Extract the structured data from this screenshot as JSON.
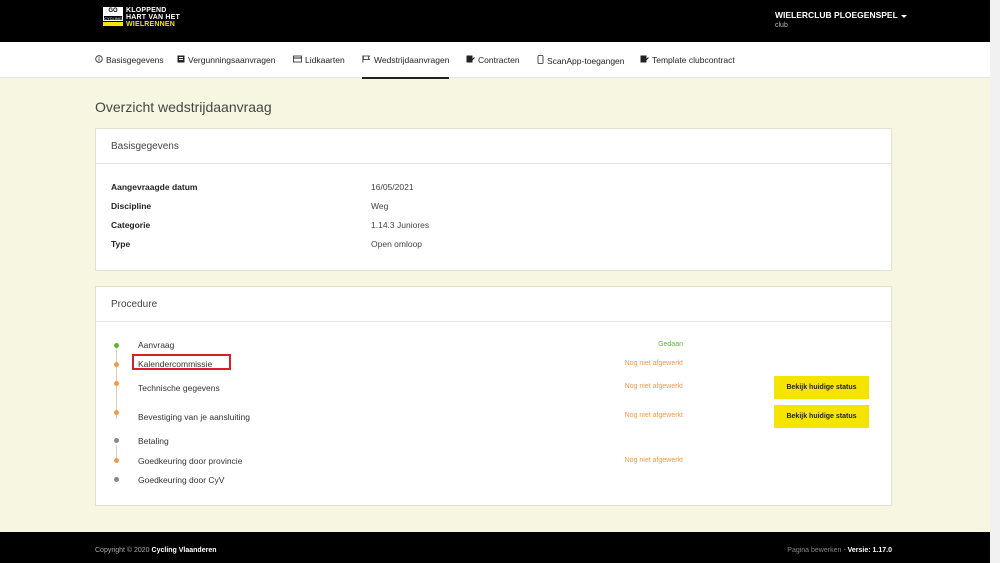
{
  "header": {
    "logo": {
      "badge_top": "GO",
      "badge_mid": "CYCLING",
      "line1": "KLOPPEND",
      "line2": "HART VAN HET",
      "line3": "WIELRENNEN"
    },
    "club_name": "WIELERCLUB PLOEGENSPEL",
    "club_role": "club"
  },
  "nav": {
    "items": [
      {
        "label": "Basisgegevens",
        "icon": "info-circle-icon"
      },
      {
        "label": "Vergunningsaanvragen",
        "icon": "id-card-icon"
      },
      {
        "label": "Lidkaarten",
        "icon": "card-icon"
      },
      {
        "label": "Wedstrijdaanvragen",
        "icon": "flag-icon",
        "active": true
      },
      {
        "label": "Contracten",
        "icon": "pen-doc-icon"
      },
      {
        "label": "ScanApp-toegangen",
        "icon": "mobile-icon"
      },
      {
        "label": "Template clubcontract",
        "icon": "pen-doc-icon"
      }
    ]
  },
  "page_title": "Overzicht wedstrijdaanvraag",
  "basis": {
    "title": "Basisgegevens",
    "rows": [
      {
        "label": "Aangevraagde datum",
        "value": "16/05/2021"
      },
      {
        "label": "Discipline",
        "value": "Weg"
      },
      {
        "label": "Categorie",
        "value": "1.14.3 Juniores"
      },
      {
        "label": "Type",
        "value": "Open omloop"
      }
    ]
  },
  "procedure": {
    "title": "Procedure",
    "steps": [
      {
        "label": "Aanvraag",
        "status": "Gedaan",
        "state": "done"
      },
      {
        "label": "Kalendercommissie",
        "status": "Nog niet afgewerkt",
        "state": "pending"
      },
      {
        "label": "Technische gegevens",
        "status": "Nog niet afgewerkt",
        "state": "pending",
        "button": "Bekijk huidige status"
      },
      {
        "label": "Bevestiging van je aansluiting",
        "status": "Nog niet afgewerkt",
        "state": "pending",
        "button": "Bekijk huidige status"
      },
      {
        "label": "Betaling",
        "status": "",
        "state": "inactive"
      },
      {
        "label": "Goedkeuring door provincie",
        "status": "Nog niet afgewerkt",
        "state": "pending"
      },
      {
        "label": "Goedkeuring door CyV",
        "status": "",
        "state": "inactive"
      }
    ]
  },
  "footer": {
    "copyright_prefix": "Copyright © 2020",
    "copyright_org": "Cycling Vlaanderen",
    "edit_link": "Pagina bewerken",
    "separator": "-",
    "version": "Versie: 1.17.0"
  },
  "colors": {
    "accent_yellow": "#f5e400",
    "done_green": "#5cb82e",
    "pending_orange": "#f39a47",
    "inactive_grey": "#888888",
    "highlight_red": "#d92026"
  }
}
